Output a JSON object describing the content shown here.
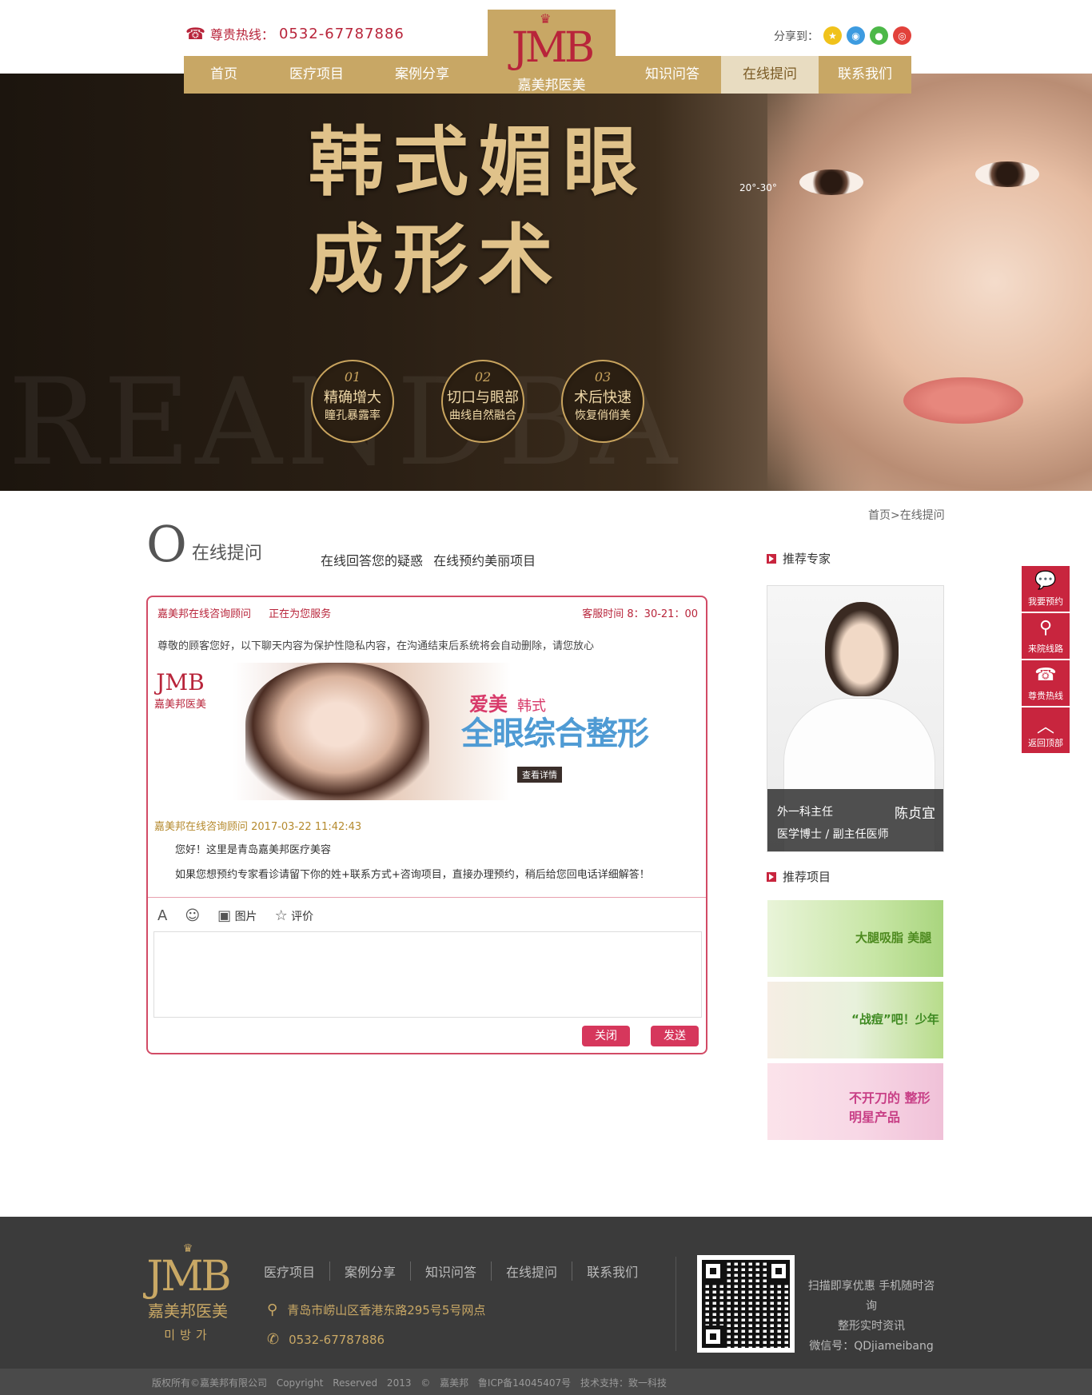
{
  "header": {
    "hotline_label": "尊贵热线：",
    "hotline_number": "0532-67787886",
    "share_label": "分享到：",
    "share_icons": [
      "star-icon",
      "qq-icon",
      "wechat-icon",
      "weibo-icon"
    ],
    "logo_mark": "JMB",
    "logo_name": "嘉美邦医美"
  },
  "nav": {
    "items": [
      "首页",
      "医疗项目",
      "案例分享",
      "知识问答",
      "在线提问",
      "联系我们"
    ],
    "active": "在线提问"
  },
  "banner": {
    "title_line1": "韩式媚眼",
    "title_line2": "成形术",
    "bg_text": "REANDBA",
    "angle": "20°-30°",
    "features": [
      {
        "num": "01",
        "a": "精确增大",
        "b": "瞳孔暴露率"
      },
      {
        "num": "02",
        "a": "切口与眼部",
        "b": "曲线自然融合"
      },
      {
        "num": "03",
        "a": "术后快速",
        "b": "恢复俏俏美"
      }
    ]
  },
  "page": {
    "breadcrumb": "首页>在线提问",
    "title_big": "O",
    "title_small": "在线提问",
    "subtitle": "在线回答您的疑惑  在线预约美丽项目"
  },
  "chat": {
    "consultant": "嘉美邦在线咨询顾问",
    "status": "正在为您服务",
    "hours": "客服时间  8：30-21：00",
    "notice": "尊敬的顾客您好，以下聊天内容为保护性隐私内容，在沟通结束后系统将会自动删除，请您放心",
    "ad": {
      "logo_mark": "JMB",
      "logo_name": "嘉美邦医美",
      "tag1": "爱美",
      "tag2": "韩式",
      "headline": "全眼综合整形",
      "button": "查看详情"
    },
    "message_meta": "嘉美邦在线咨询顾问 2017-03-22 11:42:43",
    "message1": "您好！这里是青岛嘉美邦医疗美容",
    "message2": "如果您想预约专家看诊请留下你的姓+联系方式+咨询项目，直接办理预约，稍后给您回电话详细解答！",
    "tools": {
      "font": "A",
      "emoji": "☺",
      "image": "图片",
      "rate": "评价"
    },
    "close_label": "关闭",
    "send_label": "发送"
  },
  "sidebar": {
    "expert_heading": "推荐专家",
    "expert": {
      "role": "外一科主任",
      "name": "陈贞宜",
      "degree": "医学博士 / 副主任医师"
    },
    "project_heading": "推荐项目",
    "projects": [
      {
        "text": "大腿吸脂 美腿",
        "color": "#7fbf3b"
      },
      {
        "text": "“战痘”吧！少年",
        "color": "#5aa531"
      },
      {
        "text": "不开刀的 整形明星产品",
        "color": "#d64a8e"
      }
    ]
  },
  "float_bar": {
    "items": [
      {
        "label": "我要预约",
        "icon": "chat-bubble-icon"
      },
      {
        "label": "来院线路",
        "icon": "location-pin-icon"
      },
      {
        "label": "尊贵热线",
        "icon": "phone-icon"
      },
      {
        "label": "返回顶部",
        "icon": "chevron-up-icon"
      }
    ]
  },
  "footer": {
    "logo_mark": "JMB",
    "logo_name": "嘉美邦医美",
    "logo_korean": "미방가",
    "links": [
      "医疗项目",
      "案例分享",
      "知识问答",
      "在线提问",
      "联系我们"
    ],
    "address": "青岛市崂山区香港东路295号5号网点",
    "phone": "0532-67787886",
    "qr_text1": "扫描即享优惠 手机随时咨询",
    "qr_text2": "整形实时资讯",
    "qr_text3": "微信号：QDjiameibang",
    "copyright": "版权所有©嘉美邦有限公司   Copyright Reserved 2013 © 嘉美邦   鲁ICP备14045407号   技术支持：致一科技"
  },
  "colors": {
    "gold": "#c8a765",
    "brand_red": "#c8253e",
    "chat_border": "#d24b66"
  }
}
